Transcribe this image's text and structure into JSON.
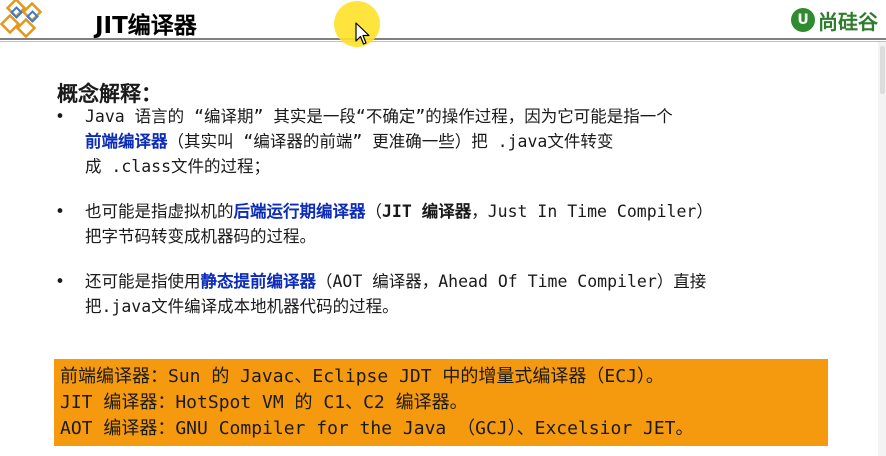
{
  "slide": {
    "title": "JIT编译器",
    "brand": {
      "mark": "U",
      "text": "尚硅谷"
    },
    "section_heading": "概念解释：",
    "bullets": [
      {
        "line1_pre": "Java 语言的 “编译期” 其实是一段“不确定”的操作过程，因为它可能是指一个",
        "line2_emph": "前端编译器",
        "line2_post": "（其实叫 “编译器的前端” 更准确一些）把 .java文件转变",
        "line3": "成 .class文件的过程；"
      },
      {
        "line1_pre": "也可能是指虚拟机的",
        "line1_emph": "后端运行期编译器",
        "line1_mid": "（",
        "line1_bold": "JIT 编译器",
        "line1_post": "，Just In Time Compiler）",
        "line2": "把字节码转变成机器码的过程。"
      },
      {
        "line1_pre": "还可能是指使用",
        "line1_emph": "静态提前编译器",
        "line1_post": "（AOT 编译器，Ahead Of Time Compiler）直接",
        "line2": "把.java文件编译成本地机器代码的过程。"
      }
    ],
    "notes": [
      "前端编译器：Sun 的 Javac、Eclipse JDT 中的增量式编译器（ECJ）。",
      "JIT 编译器：HotSpot VM 的 C1、C2 编译器。",
      "AOT 编译器：GNU Compiler for the Java （GCJ）、Excelsior JET。"
    ]
  },
  "colors": {
    "emphasis_blue": "#0d2db8",
    "note_box_orange": "#f59a0e",
    "brand_green": "#2e8b2e",
    "cursor_highlight": "#ffe128"
  },
  "icons": {
    "left_logo": "diamond-grid-logo",
    "brand_logo": "shangguigu-logo",
    "cursor": "mouse-pointer-icon"
  }
}
